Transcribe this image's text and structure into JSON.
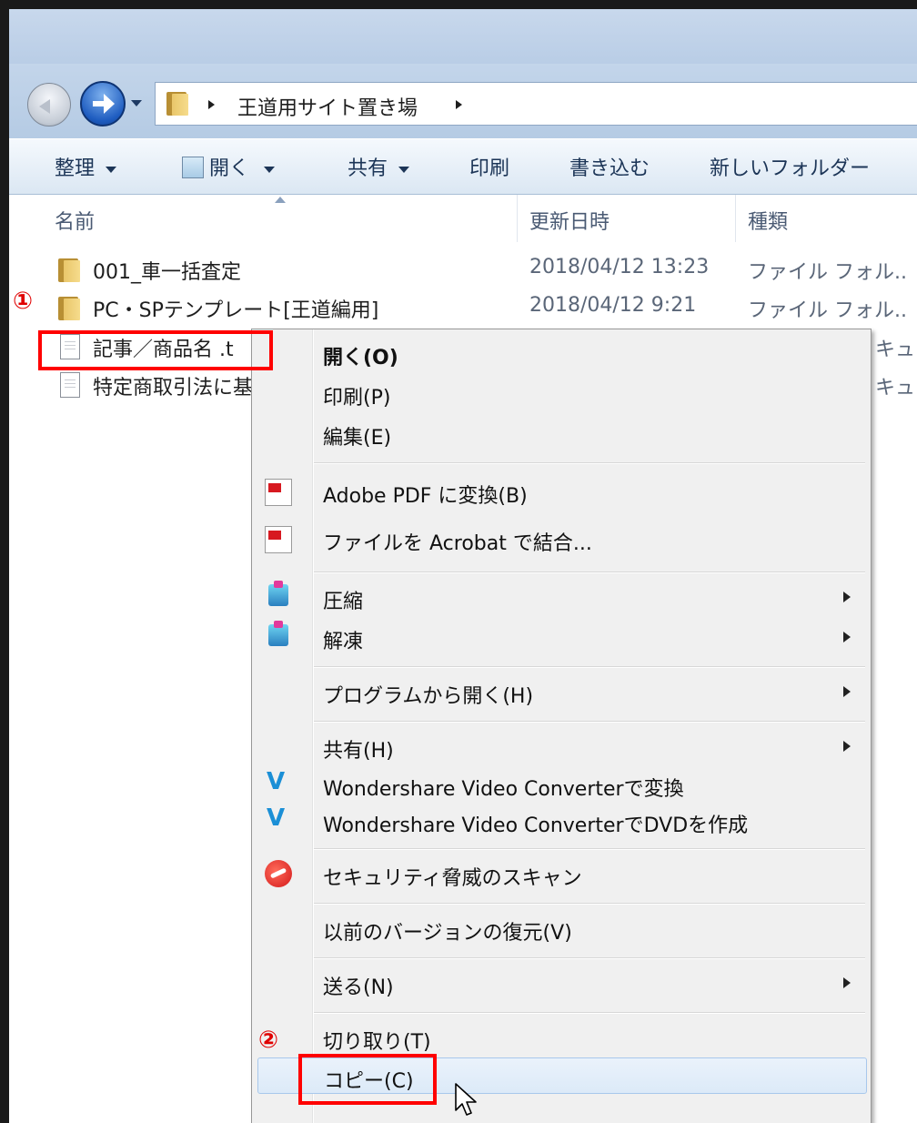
{
  "address": {
    "path": "王道用サイト置き場"
  },
  "toolbar": {
    "organize": "整理",
    "open": "開く",
    "share": "共有",
    "print": "印刷",
    "burn": "書き込む",
    "new_folder": "新しいフォルダー"
  },
  "columns": {
    "name": "名前",
    "modified": "更新日時",
    "type": "種類"
  },
  "files": [
    {
      "name": "001_車一括査定",
      "modified": "2018/04/12 13:23",
      "type": "ファイル フォル..",
      "icon": "folder-icon"
    },
    {
      "name": "PC・SPテンプレート[王道編用]",
      "modified": "2018/04/12 9:21",
      "type": "ファイル フォル..",
      "icon": "folder-icon"
    },
    {
      "name": "記事／商品名 .t",
      "modified": "",
      "type": "キュ..",
      "icon": "text-document-icon"
    },
    {
      "name": "特定商取引法に基",
      "modified": "",
      "type": "キュ..",
      "icon": "text-document-icon"
    }
  ],
  "annotations": {
    "step1": "①",
    "step2": "②",
    "color": "#ff0000"
  },
  "context_menu": {
    "items": [
      {
        "label": "開く(O)",
        "bold": true
      },
      {
        "label": "印刷(P)"
      },
      {
        "label": "編集(E)"
      },
      {
        "label": "Adobe PDF に変換(B)",
        "icon": "pdf-convert-icon"
      },
      {
        "label": "ファイルを Acrobat で結合...",
        "icon": "acrobat-combine-icon"
      },
      {
        "label": "圧縮",
        "icon": "compress-icon",
        "submenu": true
      },
      {
        "label": "解凍",
        "icon": "extract-icon",
        "submenu": true
      },
      {
        "label": "プログラムから開く(H)",
        "submenu": true
      },
      {
        "label": "共有(H)",
        "submenu": true
      },
      {
        "label": "Wondershare Video Converterで変換",
        "icon": "wondershare-icon"
      },
      {
        "label": "Wondershare Video ConverterでDVDを作成",
        "icon": "wondershare-icon"
      },
      {
        "label": "セキュリティ脅威のスキャン",
        "icon": "trendmicro-icon"
      },
      {
        "label": "以前のバージョンの復元(V)"
      },
      {
        "label": "送る(N)",
        "submenu": true
      },
      {
        "label": "切り取り(T)"
      },
      {
        "label": "コピー(C)",
        "highlighted": true
      }
    ]
  }
}
